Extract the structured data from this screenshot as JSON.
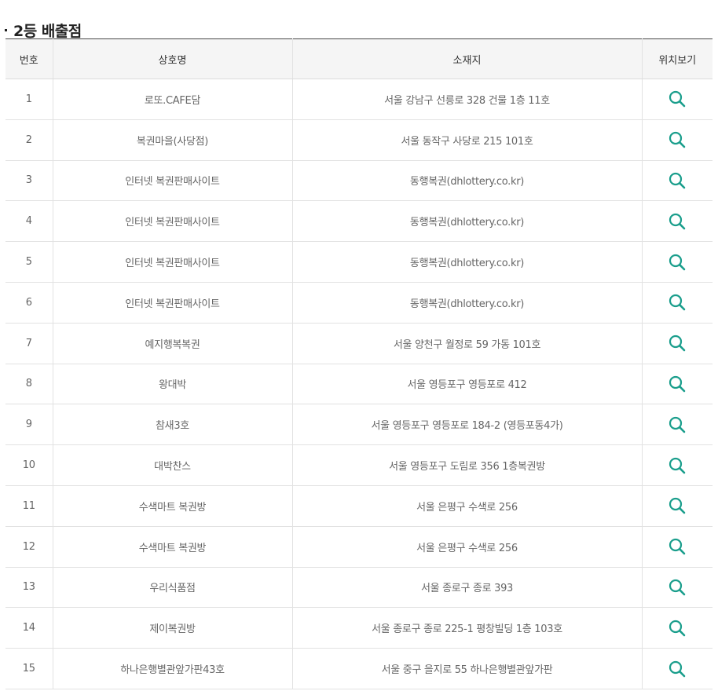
{
  "section": {
    "title": "2등 배출점"
  },
  "table": {
    "headers": {
      "no": "번호",
      "name": "상호명",
      "address": "소재지",
      "map": "위치보기"
    },
    "rows": [
      {
        "no": "1",
        "name": "로또.CAFE담",
        "address": "서울 강남구 선릉로 328 건물 1층 11호"
      },
      {
        "no": "2",
        "name": "복권마을(사당점)",
        "address": "서울 동작구 사당로 215 101호"
      },
      {
        "no": "3",
        "name": "인터넷 복권판매사이트",
        "address": "동행복권(dhlottery.co.kr)"
      },
      {
        "no": "4",
        "name": "인터넷 복권판매사이트",
        "address": "동행복권(dhlottery.co.kr)"
      },
      {
        "no": "5",
        "name": "인터넷 복권판매사이트",
        "address": "동행복권(dhlottery.co.kr)"
      },
      {
        "no": "6",
        "name": "인터넷 복권판매사이트",
        "address": "동행복권(dhlottery.co.kr)"
      },
      {
        "no": "7",
        "name": "예지행복복권",
        "address": "서울 양천구 월정로 59 가동 101호"
      },
      {
        "no": "8",
        "name": "왕대박",
        "address": "서울 영등포구 영등포로 412"
      },
      {
        "no": "9",
        "name": "참새3호",
        "address": "서울 영등포구 영등포로 184-2 (영등포동4가)"
      },
      {
        "no": "10",
        "name": "대박찬스",
        "address": "서울 영등포구 도림로 356 1층복권방"
      },
      {
        "no": "11",
        "name": "수색마트 복권방",
        "address": "서울 은평구 수색로 256"
      },
      {
        "no": "12",
        "name": "수색마트 복권방",
        "address": "서울 은평구 수색로 256"
      },
      {
        "no": "13",
        "name": "우리식품점",
        "address": "서울 종로구 종로 393"
      },
      {
        "no": "14",
        "name": "제이복권방",
        "address": "서울 종로구 종로 225-1 평창빌딩 1층 103호"
      },
      {
        "no": "15",
        "name": "하나은행별관앞가판43호",
        "address": "서울 중구 을지로 55 하나은행별관앞가판"
      }
    ]
  },
  "icons": {
    "map_view": "search-icon"
  },
  "colors": {
    "icon": "#1a9e8c",
    "header_bg": "#f5f5f5",
    "top_border": "#4a4a4a"
  }
}
